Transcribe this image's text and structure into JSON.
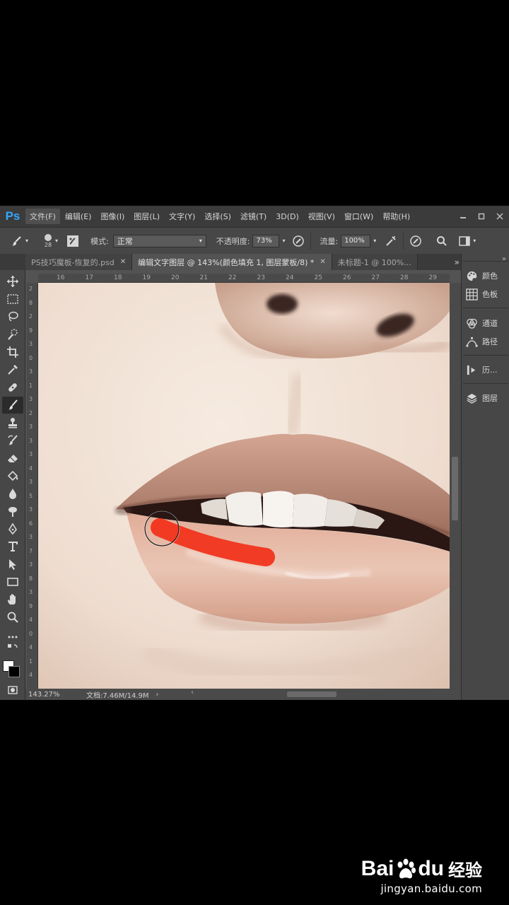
{
  "app": {
    "logo": "Ps"
  },
  "menu": [
    "文件(F)",
    "编辑(E)",
    "图像(I)",
    "图层(L)",
    "文字(Y)",
    "选择(S)",
    "滤镜(T)",
    "3D(D)",
    "视图(V)",
    "窗口(W)",
    "帮助(H)"
  ],
  "window_controls": {
    "minimize": "▭",
    "restore": "□",
    "close": "✕"
  },
  "options": {
    "brush_size": "28",
    "mode_label": "模式:",
    "mode_value": "正常",
    "opacity_label": "不透明度:",
    "opacity_value": "73%",
    "flow_label": "流量:",
    "flow_value": "100%"
  },
  "tabs": [
    {
      "label": "PS技巧魔板-恢复的.psd",
      "close": "✕",
      "active": false
    },
    {
      "label": "编辑文字图层 @ 143%(颜色填充 1, 图层蒙板/8) *",
      "close": "✕",
      "active": true
    },
    {
      "label": "未标题-1 @ 100%...",
      "close": "",
      "active": false
    }
  ],
  "tab_overflow": "»",
  "ruler_top": [
    "16",
    "17",
    "18",
    "19",
    "20",
    "21",
    "22",
    "23",
    "24",
    "25",
    "26",
    "27",
    "28",
    "29"
  ],
  "ruler_left": [
    "2",
    "8",
    "2",
    "9",
    "3",
    "0",
    "3",
    "1",
    "3",
    "2",
    "3",
    "3",
    "3",
    "4",
    "3",
    "5",
    "3",
    "6",
    "3",
    "7",
    "3",
    "8",
    "3",
    "9",
    "4",
    "0",
    "4",
    "1",
    "4"
  ],
  "status": {
    "zoom": "143.27%",
    "doc": "文档:7.46M/14.9M",
    "arrow": "›"
  },
  "dock": [
    {
      "label": "颜色",
      "icon": "palette-icon"
    },
    {
      "label": "色板",
      "icon": "swatches-icon"
    },
    {
      "label": "通道",
      "icon": "channels-icon"
    },
    {
      "label": "路径",
      "icon": "paths-icon"
    },
    {
      "label": "历...",
      "icon": "history-icon"
    },
    {
      "label": "图层",
      "icon": "layers-icon"
    }
  ],
  "brush_color": "#f2341c",
  "watermark": {
    "bai": "Bai",
    "du": "du",
    "jingyan": "经验",
    "url": "jingyan.baidu.com"
  }
}
